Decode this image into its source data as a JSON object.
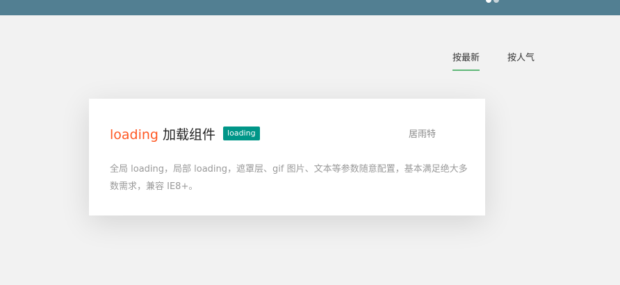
{
  "tabs": [
    {
      "label": "按最新",
      "active": true
    },
    {
      "label": "按人气",
      "active": false
    }
  ],
  "card": {
    "title_highlight": "loading",
    "title_rest": " 加载组件",
    "badge": "loading",
    "author": "居雨特",
    "description": "全局 loading，局部 loading，遮罩层、gif 图片、文本等参数随意配置，基本满足绝大多数需求，兼容 IE8+。"
  },
  "colors": {
    "topbar": "#527f92",
    "accent_green": "#5fb878",
    "title_highlight": "#ff5722",
    "badge_bg": "#009688"
  }
}
